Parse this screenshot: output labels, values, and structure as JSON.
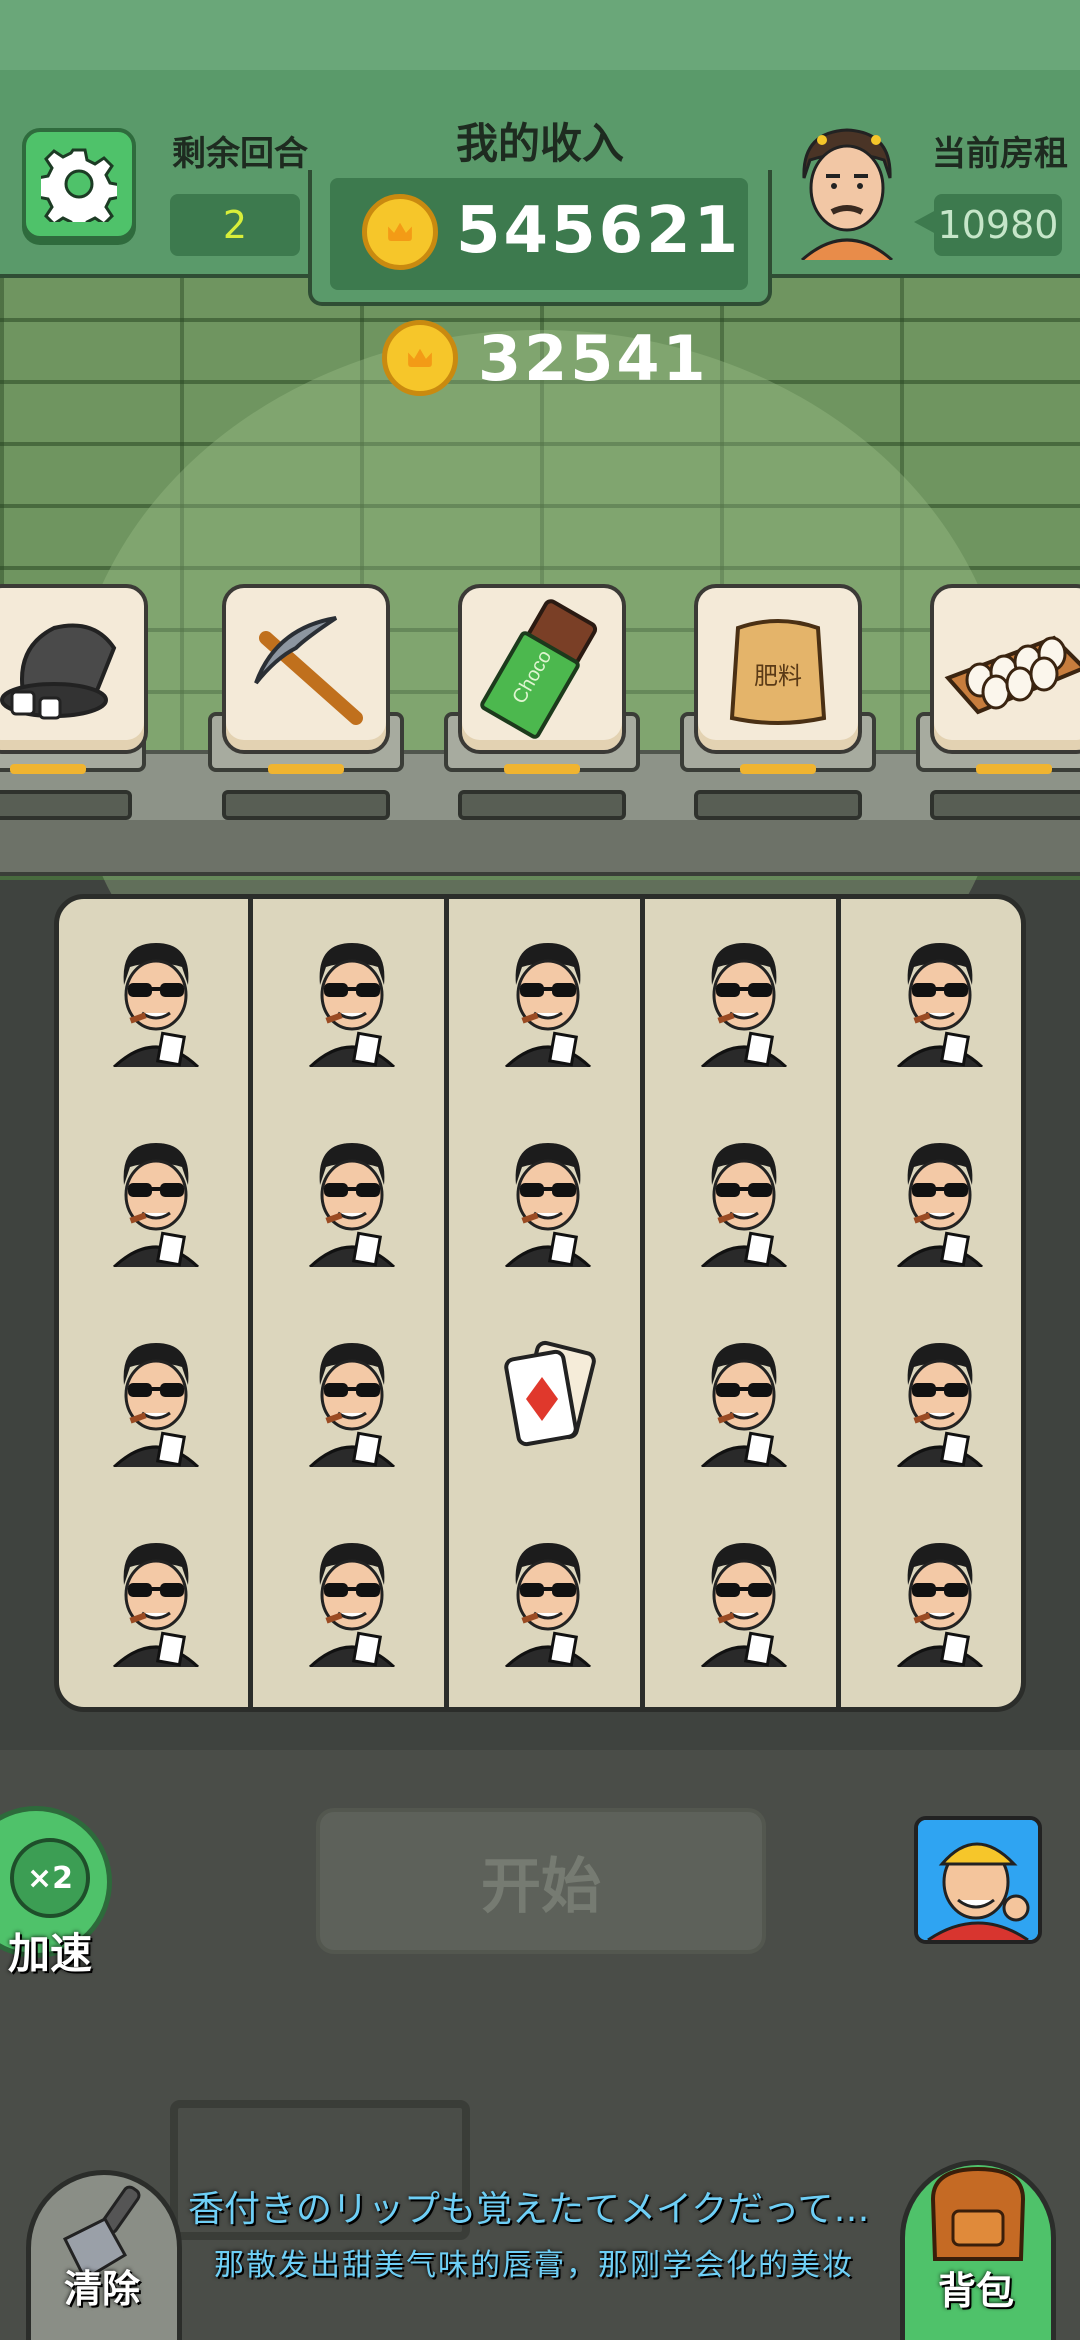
{
  "header": {
    "rounds_label": "剩余回合",
    "rounds_value": "2",
    "income_label": "我的收入",
    "income_value": "545621",
    "rent_label": "当前房租",
    "rent_value": "10980",
    "bonus_value": "32541"
  },
  "shelf": {
    "items": [
      {
        "icon": "dice-cup-icon"
      },
      {
        "icon": "pickaxe-icon"
      },
      {
        "icon": "chocolate-icon",
        "text": "Choco"
      },
      {
        "icon": "fertilizer-bag-icon",
        "text": "肥料"
      },
      {
        "icon": "egg-tray-icon"
      }
    ]
  },
  "board": {
    "columns": [
      [
        "gambler",
        "gambler",
        "gambler",
        "gambler"
      ],
      [
        "gambler",
        "gambler",
        "gambler",
        "gambler"
      ],
      [
        "gambler",
        "gambler",
        "cards",
        "gambler"
      ],
      [
        "gambler",
        "gambler",
        "gambler",
        "gambler"
      ],
      [
        "gambler",
        "gambler",
        "gambler",
        "gambler"
      ]
    ]
  },
  "controls": {
    "start_label": "开始",
    "speed_badge": "×2",
    "speed_label": "加速",
    "clear_label": "清除",
    "bag_label": "背包"
  },
  "subtitle": {
    "line1": "香付きのリップも覚えたてメイクだって…",
    "line2": "那散发出甜美气味的唇膏，那刚学会化的美妆"
  },
  "colors": {
    "accent_green": "#4fc26a",
    "panel_green": "#3d7a4e",
    "round_text": "#d8ee3a",
    "subtitle": "#6ecff6"
  }
}
